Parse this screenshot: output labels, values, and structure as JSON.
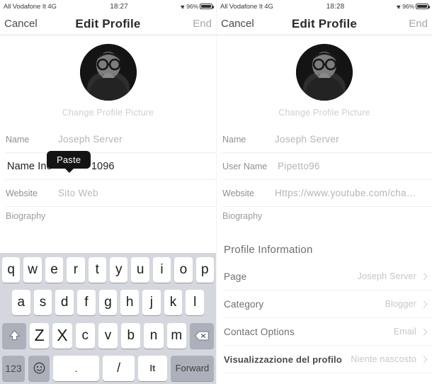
{
  "screens": [
    {
      "id": "left",
      "status_bar": {
        "carrier": "All Vodafone It 4G",
        "time": "18:27",
        "battery_percent": "96%",
        "location_icon": "location-arrow-icon",
        "battery_icon": "battery-icon"
      },
      "nav": {
        "cancel": "Cancel",
        "title": "Edit Profile",
        "end": "End"
      },
      "avatar": {
        "alt": "profile-photo",
        "change_label": "Change Profile Picture"
      },
      "form": {
        "name": {
          "label": "Name",
          "value": "Joseph Server"
        },
        "username": {
          "label": "User Name Inc",
          "value": "1096",
          "text": "Name Inc",
          "suffix": "1096"
        },
        "website": {
          "label": "Website",
          "placeholder": "Sito Web"
        },
        "biography": {
          "label": "Biography",
          "value": ""
        }
      },
      "paste_bubble": {
        "label": "Paste"
      },
      "keyboard": {
        "row1": [
          "q",
          "w",
          "e",
          "r",
          "t",
          "y",
          "u",
          "i",
          "o",
          "p"
        ],
        "row2": [
          "a",
          "s",
          "d",
          "f",
          "g",
          "h",
          "j",
          "k",
          "l"
        ],
        "row3_shift": "shift-icon",
        "row3": [
          "Z",
          "X",
          "c",
          "v",
          "b",
          "n",
          "m"
        ],
        "row3_delete": "delete-icon",
        "row4": {
          "numbers": "123",
          "emoji": "emoji-icon",
          "period": ".",
          "slash": "/",
          "lang": "It",
          "forward": "Forward"
        }
      }
    },
    {
      "id": "right",
      "status_bar": {
        "carrier": "All Vodafone It 4G",
        "time": "18:28",
        "battery_percent": "96%",
        "location_icon": "location-arrow-icon",
        "battery_icon": "battery-icon"
      },
      "nav": {
        "cancel": "Cancel",
        "title": "Edit Profile",
        "end": "End"
      },
      "avatar": {
        "alt": "profile-photo",
        "change_label": "Change Profile Picture"
      },
      "form": {
        "name": {
          "label": "Name",
          "value": "Joseph Server"
        },
        "username": {
          "label": "User Name",
          "value": "Pipetto96"
        },
        "website": {
          "label": "Website",
          "value": "Https://www.youtube.com/cha…"
        },
        "biography": {
          "label": "Biography",
          "value": ""
        }
      },
      "profile_information": {
        "header": "Profile Information",
        "rows": [
          {
            "label": "Page",
            "value": "Joseph Server"
          },
          {
            "label": "Category",
            "value": "Blogger"
          },
          {
            "label": "Contact Options",
            "value": "Email"
          },
          {
            "label": "Visualizzazione del profilo",
            "value": "Niente nascosto"
          }
        ]
      }
    }
  ],
  "colors": {
    "keyboard_bg": "#d4d7dd",
    "key_bg": "#ffffff",
    "key_special_bg": "#abb0ba",
    "paste_bubble": "#141414",
    "muted_text": "#b9b9b9"
  }
}
